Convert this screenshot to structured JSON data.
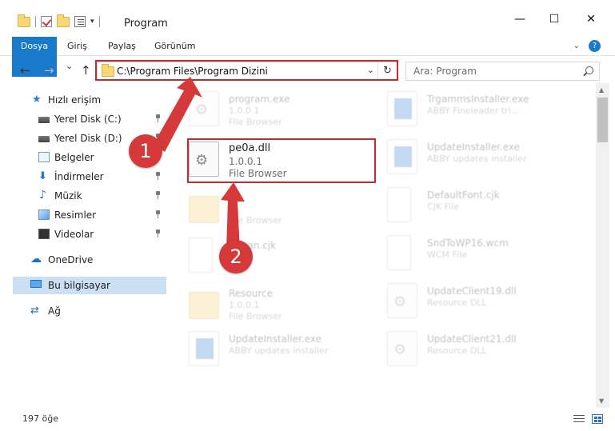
{
  "window": {
    "title": "Program",
    "minimize_glyph": "—",
    "maximize_glyph": "☐",
    "close_glyph": "✕"
  },
  "ribbon": {
    "tabs": [
      "Dosya",
      "Giriş",
      "Paylaş",
      "Görünüm"
    ],
    "help_glyph": "?",
    "accent_color": "#1979ca"
  },
  "navigation": {
    "back_glyph": "←",
    "forward_glyph": "→",
    "recent_glyph": "⌄",
    "up_glyph": "↑",
    "address": "C:\\Program Files\\Program Dizini",
    "address_dropdown_glyph": "⌄",
    "refresh_glyph": "↻",
    "search_placeholder": "Ara: Program"
  },
  "sidebar": {
    "items": [
      {
        "label": "Hızlı erişim",
        "icon": "star-icon"
      },
      {
        "label": "Yerel Disk (C:)",
        "icon": "disk-icon",
        "pinned": true
      },
      {
        "label": "Yerel Disk (D:)",
        "icon": "disk-icon",
        "pinned": true
      },
      {
        "label": "Belgeler",
        "icon": "documents-icon",
        "pinned": true
      },
      {
        "label": "İndirmeler",
        "icon": "download-icon",
        "pinned": true
      },
      {
        "label": "Müzik",
        "icon": "music-icon",
        "pinned": true
      },
      {
        "label": "Resimler",
        "icon": "pictures-icon",
        "pinned": true
      },
      {
        "label": "Videolar",
        "icon": "videos-icon",
        "pinned": true
      },
      {
        "label": "OneDrive",
        "icon": "cloud-icon"
      },
      {
        "label": "Bu bilgisayar",
        "icon": "computer-icon",
        "selected": true
      },
      {
        "label": "Ağ",
        "icon": "network-icon"
      }
    ]
  },
  "files": {
    "left": [
      {
        "name": "program.exe",
        "line2": "1.0.0.1",
        "line3": "File Browser",
        "icon": "program-icon"
      },
      {
        "name": "pe0a.dll",
        "line2": "1.0.0.1",
        "line3": "File Browser",
        "icon": "dll-gear-icon"
      },
      {
        "name": "",
        "line2": "1",
        "line3": "File Browser",
        "icon": "folder-icon"
      },
      {
        "name": "...rean.cjk",
        "line2": "",
        "line3": "",
        "icon": "blank-file-icon"
      },
      {
        "name": "Resource",
        "line2": "1.0.0.1",
        "line3": "File Browser",
        "icon": "folder-icon"
      },
      {
        "name": "UpdateInstaller.exe",
        "line2": "ABBY updates installer",
        "line3": "",
        "icon": "installer-icon"
      }
    ],
    "right": [
      {
        "name": "TrgammsInstaller.exe",
        "line2": "ABBY Fineleader tri...",
        "line3": "",
        "icon": "installer-icon"
      },
      {
        "name": "UpdateInstaller.exe",
        "line2": "ABBY updates installer",
        "line3": "",
        "icon": "installer-icon"
      },
      {
        "name": "DefaultFont.cjk",
        "line2": "CJK File",
        "line3": "",
        "icon": "blank-file-icon"
      },
      {
        "name": "SndToWP16.wcm",
        "line2": "WCM File",
        "line3": "",
        "icon": "blank-file-icon"
      },
      {
        "name": "UpdateClient19.dll",
        "line2": "Resource DLL",
        "line3": "",
        "icon": "dll-gear-icon"
      },
      {
        "name": "UpdateClient21.dll",
        "line2": "Resource DLL",
        "line3": "",
        "icon": "dll-gear-icon"
      }
    ]
  },
  "annotations": {
    "step1": "1",
    "step2": "2",
    "highlight_color": "#c8282f"
  },
  "status": {
    "item_count": "197 öğe"
  }
}
